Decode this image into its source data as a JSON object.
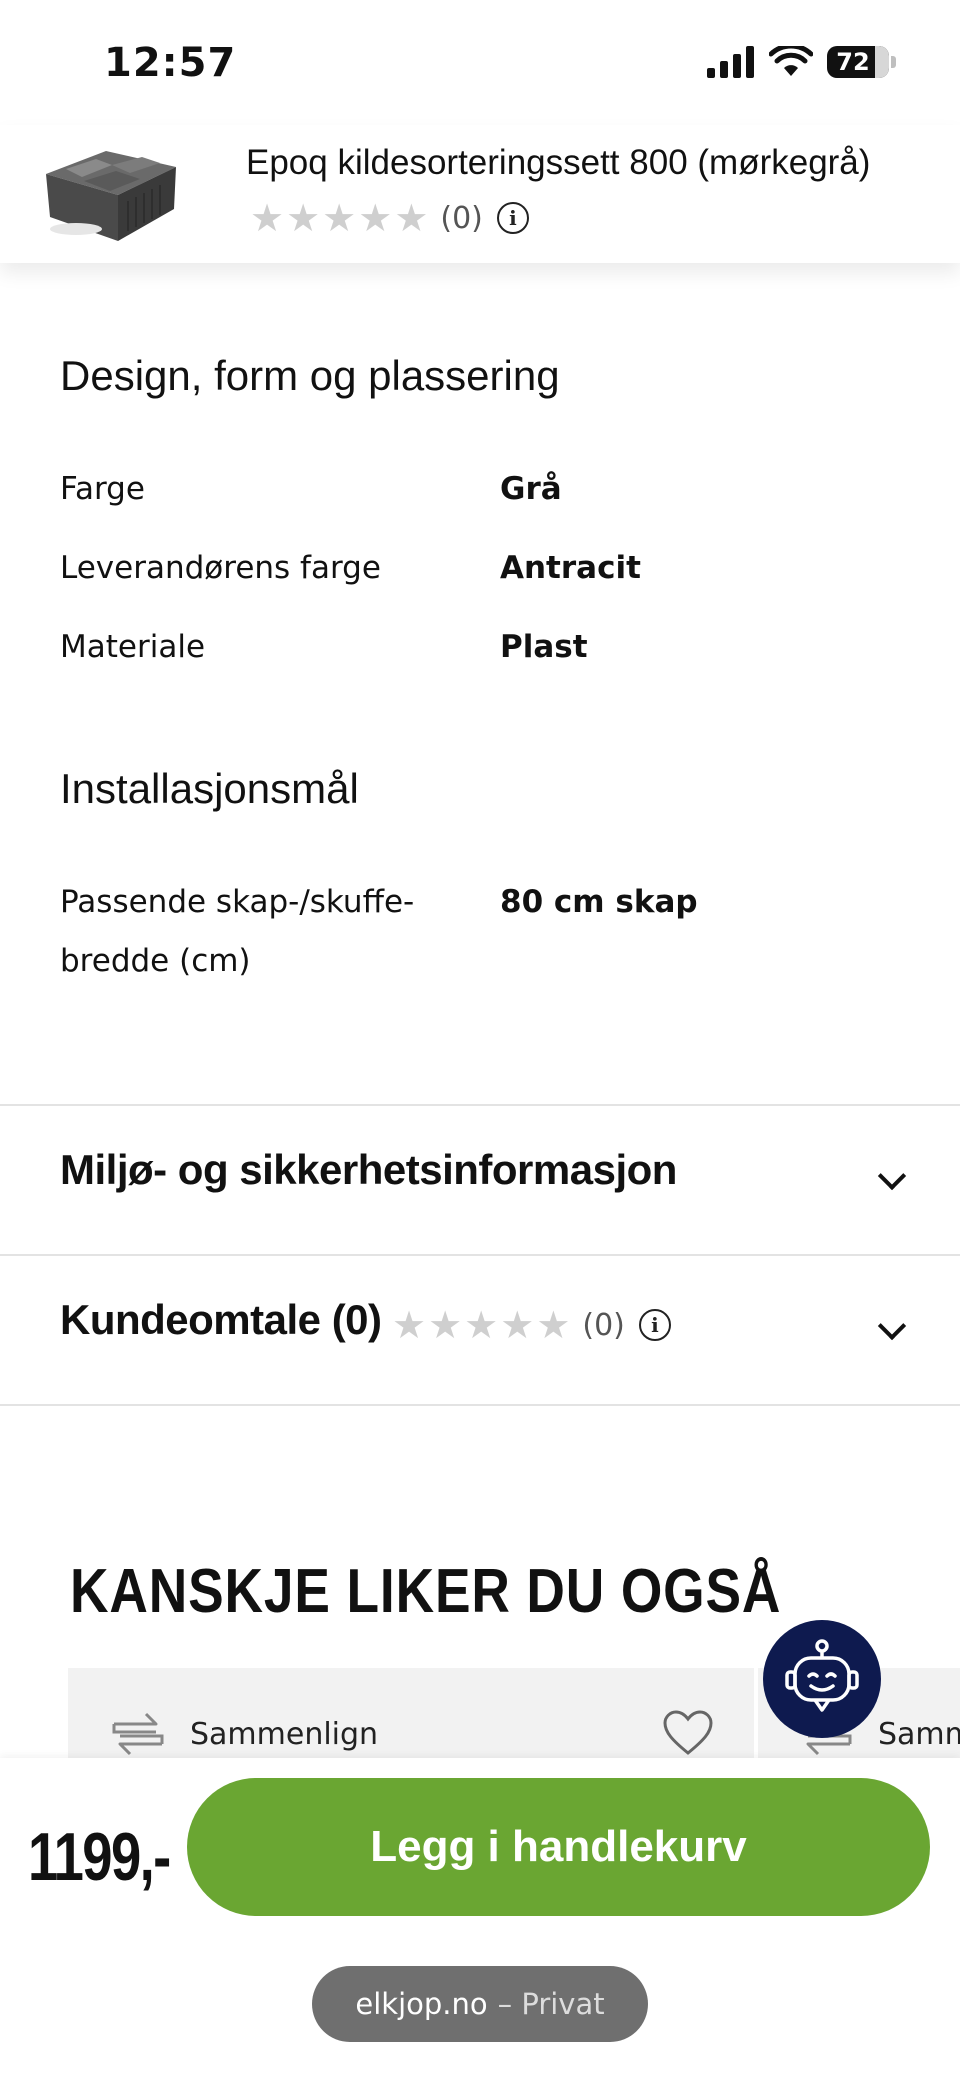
{
  "status_bar": {
    "time": "12:57",
    "battery": "72"
  },
  "product": {
    "title": "Epoq kildesorteringssett 800 (mørkegrå)",
    "rating_count": "(0)"
  },
  "specs": [
    {
      "title": "Design, form og plassering",
      "rows": [
        {
          "label": "Farge",
          "value": "Grå"
        },
        {
          "label": "Leverandørens farge",
          "value": "Antracit"
        },
        {
          "label": "Materiale",
          "value": "Plast"
        }
      ]
    },
    {
      "title": "Installasjonsmål",
      "rows": [
        {
          "label_line1": "Passende skap-/skuffe-",
          "label_line2": "bredde (cm)",
          "value": "80 cm skap"
        }
      ]
    }
  ],
  "accordions": {
    "environment": {
      "title": "Miljø- og sikkerhetsinformasjon"
    },
    "reviews": {
      "title": "Kundeomtale (0)",
      "rating_count": "(0)"
    }
  },
  "recommendations": {
    "title": "KANSKJE LIKER DU OGSÅ",
    "compare_label": "Sammenlign",
    "compare_label_partial": "Samm"
  },
  "bottom": {
    "price": "1199,-",
    "cart_label": "Legg i handlekurv",
    "url_domain": "elkjop.no",
    "url_mode": "– Privat"
  },
  "colors": {
    "cart_green": "#6aa632",
    "chatbot_navy": "#0e1a4f",
    "star_gray": "#cfcfcf"
  },
  "icons": [
    "signal-icon",
    "wifi-icon",
    "battery-icon",
    "star-icon",
    "info-icon",
    "chevron-down-icon",
    "compare-icon",
    "heart-icon",
    "chatbot-icon"
  ]
}
